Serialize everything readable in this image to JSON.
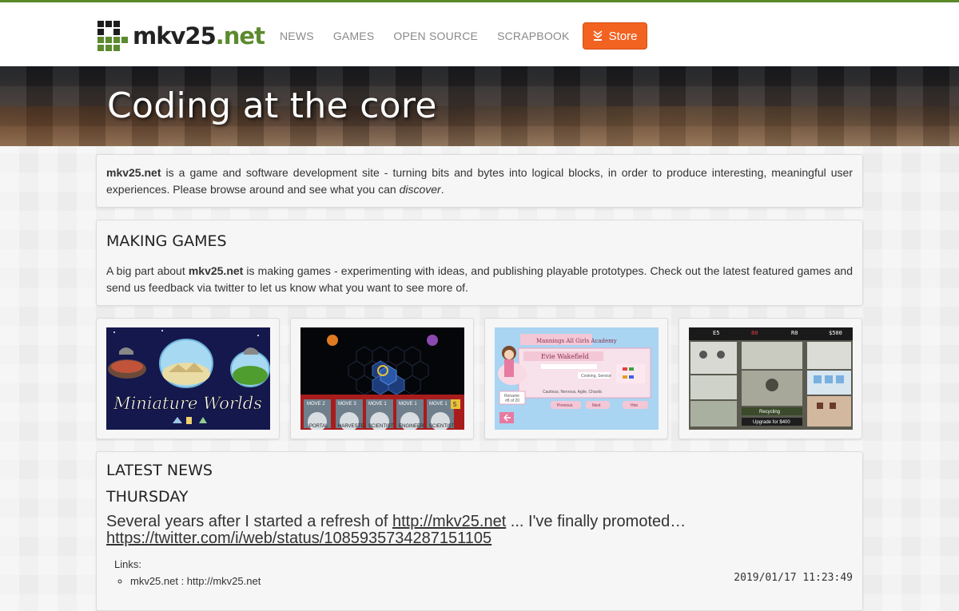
{
  "site": {
    "logo_main": "mkv25",
    "logo_ext": ".net"
  },
  "nav": {
    "links": [
      "NEWS",
      "GAMES",
      "OPEN SOURCE",
      "SCRAPBOOK"
    ],
    "store_label": "Store"
  },
  "banner": {
    "title": "Coding at the core"
  },
  "intro": {
    "brand": "mkv25.net",
    "text": " is a game and software development site - turning bits and bytes into logical blocks, in order to produce interesting, meaningful user experiences. Please browse around and see what you can ",
    "emph": "discover",
    "end": "."
  },
  "making": {
    "title": "MAKING GAMES",
    "pre": "A big part about ",
    "brand": "mkv25.net",
    "post": " is making games - experimenting with ideas, and publishing playable prototypes. Check out the latest featured games and send us feedback via twitter to let us know what you want to see more of."
  },
  "games": [
    {
      "title": "Miniature Worlds"
    },
    {
      "moves": [
        "MOVE 2",
        "MOVE 3",
        "MOVE 1",
        "MOVE 1",
        "MOVE 1"
      ],
      "labels": [
        "PORTAL",
        "HARVESTE",
        "SCIENTIST",
        "ENGINEER",
        "SCIENTIST"
      ],
      "badge": "5"
    },
    {
      "academy": "Mannings All Girls Academy",
      "name": "Evie Wakefield",
      "trait": "Cooking, Service",
      "traits2": "Cautious, Nervous, Agile, Chaotic",
      "buttons": [
        "Previous",
        "Next",
        "Hire"
      ],
      "side_label": "Rename",
      "side_sub": "#8 of 20"
    },
    {
      "stats": [
        "E5",
        "80",
        "R0",
        "$500"
      ],
      "labels": [
        "Recycling",
        "Upgrade for $400"
      ]
    }
  ],
  "news": {
    "title": "LATEST NEWS",
    "day": "THURSDAY",
    "headline_pre": "Several years after I started a refresh of ",
    "headline_link1": "http://mkv25.net",
    "headline_mid": " ... I've finally promoted… ",
    "headline_link2": "https://twitter.com/i/web/status/1085935734287151105",
    "links_label": "Links:",
    "timestamp": "2019/01/17 11:23:49",
    "links": [
      "mkv25.net : http://mkv25.net"
    ]
  },
  "colors": {
    "accent_green": "#5c8a2e",
    "store_orange": "#f26322"
  }
}
